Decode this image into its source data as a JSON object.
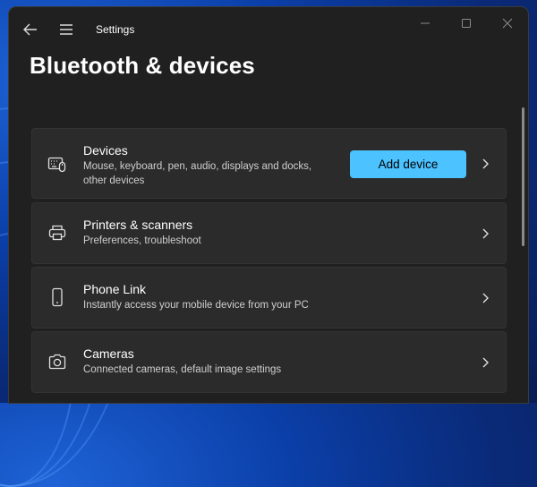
{
  "window": {
    "title": "Settings"
  },
  "page": {
    "title": "Bluetooth & devices"
  },
  "devices": {
    "title": "Devices",
    "subtitle_line1": "Mouse, keyboard, pen, audio, displays and docks,",
    "subtitle_line2": "other devices",
    "button_label": "Add device"
  },
  "printers": {
    "title": "Printers & scanners",
    "subtitle": "Preferences, troubleshoot"
  },
  "phone": {
    "title": "Phone Link",
    "subtitle": "Instantly access your mobile device from your PC"
  },
  "cameras": {
    "title": "Cameras",
    "subtitle": "Connected cameras, default image settings"
  },
  "icons": {
    "back": "back-arrow-icon",
    "menu": "hamburger-menu-icon",
    "minimize": "minimize-icon",
    "maximize": "maximize-icon",
    "close": "close-icon",
    "devices": "keyboard-mouse-icon",
    "printers": "printer-icon",
    "phone": "phone-icon",
    "cameras": "camera-icon",
    "chevron": "chevron-right-icon"
  },
  "colors": {
    "accent": "#4cc2ff",
    "window_bg": "#202020",
    "card_bg": "#2b2b2b"
  }
}
